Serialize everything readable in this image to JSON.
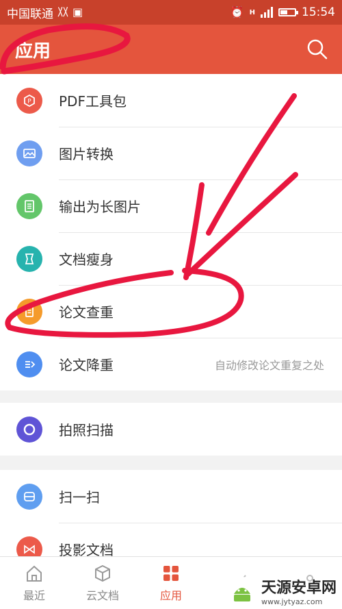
{
  "status_bar": {
    "carrier": "中国联通",
    "time": "15:54",
    "network": "H"
  },
  "header": {
    "title": "应用"
  },
  "groups": [
    {
      "items": [
        {
          "label": "PDF工具包",
          "icon": "pdf-toolkit-icon",
          "color": "#ec5a4a"
        },
        {
          "label": "图片转换",
          "icon": "image-convert-icon",
          "color": "#6f9ef0"
        },
        {
          "label": "输出为长图片",
          "icon": "long-image-icon",
          "color": "#63c66a"
        },
        {
          "label": "文档瘦身",
          "icon": "doc-slim-icon",
          "color": "#27b3ae"
        },
        {
          "label": "论文查重",
          "icon": "paper-check-icon",
          "color": "#f59b2b"
        },
        {
          "label": "论文降重",
          "icon": "paper-reduce-icon",
          "color": "#4f8ef0",
          "hint": "自动修改论文重复之处"
        }
      ]
    },
    {
      "items": [
        {
          "label": "拍照扫描",
          "icon": "photo-scan-icon",
          "color": "#5f54d6"
        }
      ]
    },
    {
      "items": [
        {
          "label": "扫一扫",
          "icon": "scan-icon",
          "color": "#5f9ef0"
        },
        {
          "label": "投影文档",
          "icon": "projection-icon",
          "color": "#ec5a4a"
        }
      ]
    }
  ],
  "bottom_nav": [
    {
      "label": "最近"
    },
    {
      "label": "云文档"
    },
    {
      "label": "应用",
      "active": true
    },
    {
      "label": ""
    },
    {
      "label": ""
    }
  ],
  "watermark": {
    "title": "天源安卓网",
    "url": "www.jytyaz.com"
  },
  "colors": {
    "header": "#e4553d",
    "status_bar": "#c8412b",
    "annotation": "#e8173f"
  }
}
